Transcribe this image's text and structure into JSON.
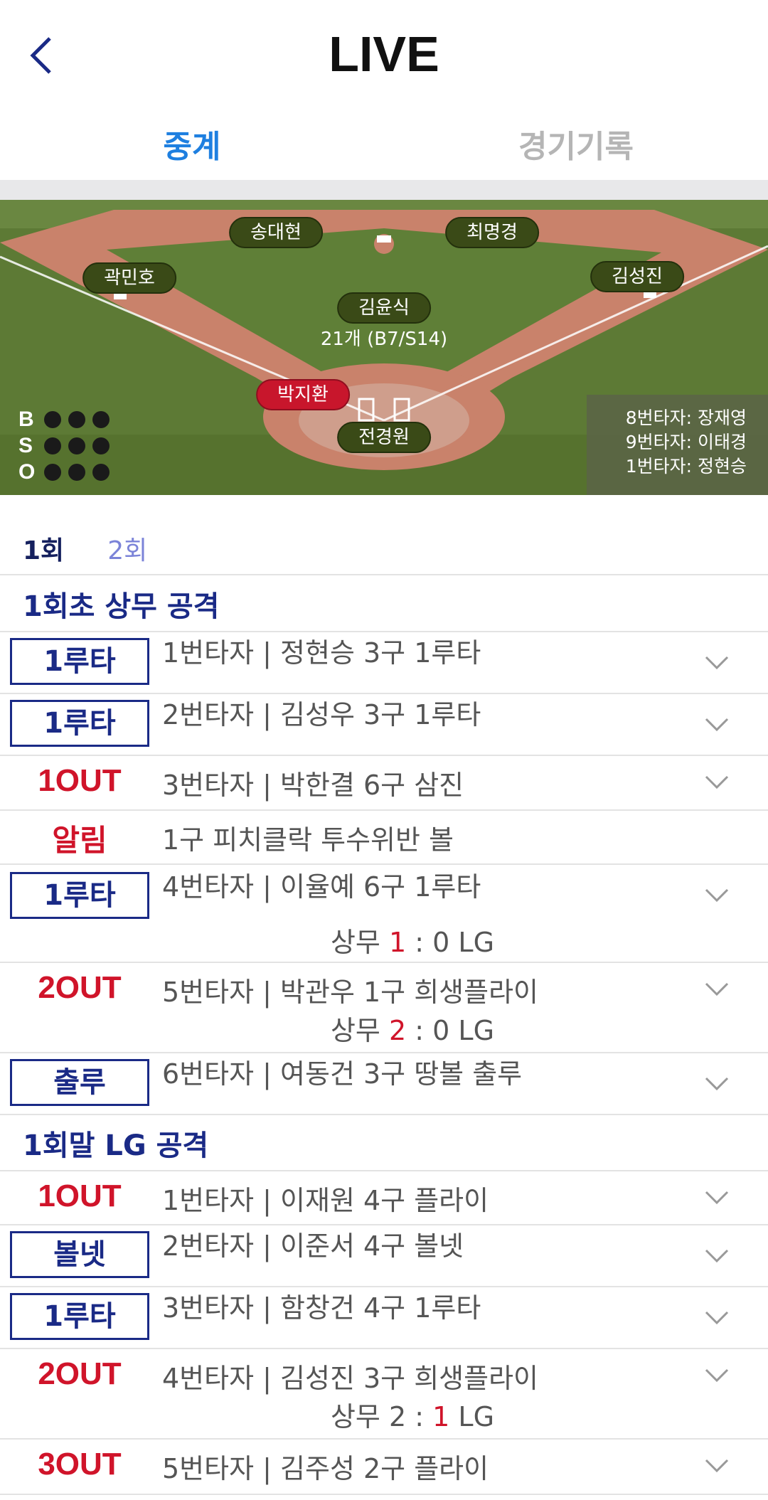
{
  "header": {
    "title": "LIVE",
    "back_icon": "chevron-left-icon"
  },
  "tabs": [
    {
      "label": "중계",
      "active": true
    },
    {
      "label": "경기기록",
      "active": false
    }
  ],
  "field": {
    "fielders": [
      "송대현",
      "최명경",
      "곽민호",
      "김성진",
      "김윤식"
    ],
    "pitch_count": "21개 (B7/S14)",
    "runner": "박지환",
    "batter": "전경원",
    "bso_labels": [
      "B",
      "S",
      "O"
    ],
    "next_batters": [
      "8번타자: 장재영",
      "9번타자: 이태경",
      "1번타자: 정현승"
    ]
  },
  "innings": [
    {
      "label": "1회",
      "active": true
    },
    {
      "label": "2회",
      "active": false
    }
  ],
  "sections": [
    "1회초 상무 공격",
    "1회말 LG 공격"
  ],
  "plays": [
    {
      "badge": "1루타",
      "type": "box",
      "text": "1번타자 | 정현승 3구 1루타"
    },
    {
      "badge": "1루타",
      "type": "box",
      "text": "2번타자 | 김성우 3구 1루타"
    },
    {
      "badge": "1OUT",
      "type": "out",
      "text": "3번타자 | 박한결 6구 삼진"
    },
    {
      "badge": "알림",
      "type": "alert",
      "text": "1구 피치클락 투수위반 볼"
    },
    {
      "badge": "1루타",
      "type": "box",
      "text": "4번타자 | 이율예 6구 1루타",
      "score": {
        "home": "상무",
        "home_score": "1",
        "sep": " : ",
        "away_score": "0",
        "away": "LG"
      }
    },
    {
      "badge": "2OUT",
      "type": "out",
      "text": "5번타자 | 박관우 1구 희생플라이",
      "score": {
        "home": "상무",
        "home_score": "2",
        "sep": " : ",
        "away_score": "0",
        "away": "LG"
      }
    },
    {
      "badge": "출루",
      "type": "box",
      "text": "6번타자 | 여동건 3구 땅볼 출루"
    },
    {
      "badge": "1OUT",
      "type": "out",
      "text": "1번타자 | 이재원 4구 플라이"
    },
    {
      "badge": "볼넷",
      "type": "box",
      "text": "2번타자 | 이준서 4구 볼넷"
    },
    {
      "badge": "1루타",
      "type": "box",
      "text": "3번타자 | 함창건 4구 1루타"
    },
    {
      "badge": "2OUT",
      "type": "out",
      "text": "4번타자 | 김성진 3구 희생플라이",
      "score": {
        "home": "상무",
        "home_score": "2",
        "sep": " : ",
        "away_score": "1",
        "away": "LG"
      }
    },
    {
      "badge": "3OUT",
      "type": "out",
      "text": "5번타자 | 김주성 2구 플라이"
    }
  ],
  "colors": {
    "accent": "#1e7fe0",
    "navy": "#1a2a86",
    "red": "#d0142a"
  }
}
